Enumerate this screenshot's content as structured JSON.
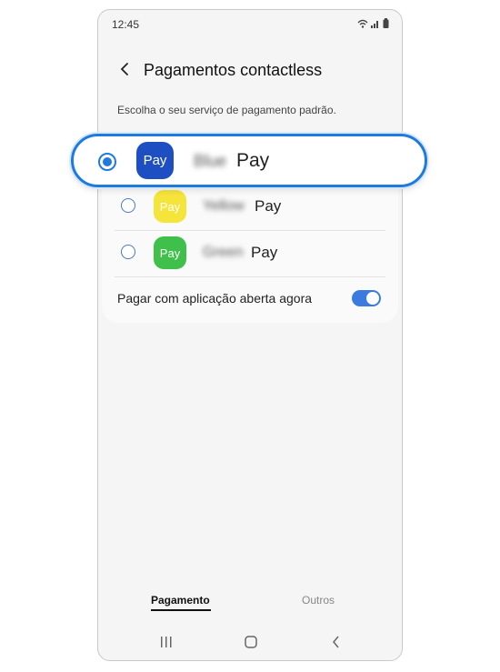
{
  "status": {
    "time": "12:45"
  },
  "header": {
    "title": "Pagamentos contactless"
  },
  "subtitle": "Escolha o seu serviço de pagamento padrão.",
  "payment_options": [
    {
      "icon_text": "Pay",
      "name_blurred": "Blue",
      "name_suffix": "Pay",
      "color": "#1d4ec2",
      "selected": true
    },
    {
      "icon_text": "Pay",
      "name_blurred": "Yellow",
      "name_suffix": "Pay",
      "color": "#f5e43a",
      "selected": false
    },
    {
      "icon_text": "Pay",
      "name_blurred": "Green",
      "name_suffix": "Pay",
      "color": "#3ec04a",
      "selected": false
    }
  ],
  "toggle": {
    "label": "Pagar com aplicação aberta agora",
    "on": true,
    "color": "#3b7be0"
  },
  "tabs": [
    {
      "label": "Pagamento",
      "active": true
    },
    {
      "label": "Outros",
      "active": false
    }
  ],
  "accent_color": "#1f7ae0"
}
